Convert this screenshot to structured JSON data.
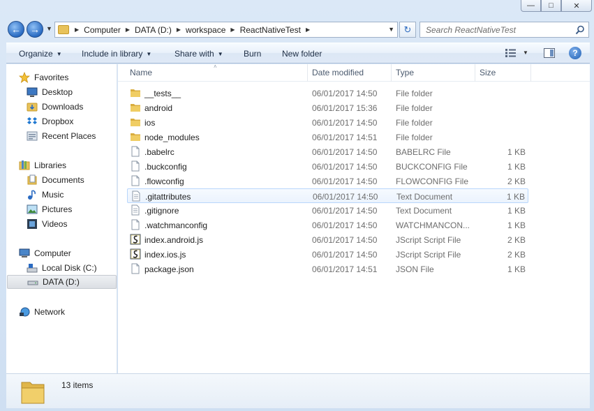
{
  "window": {
    "controls": {
      "minimize": "—",
      "maximize": "□",
      "close": "✕"
    }
  },
  "address": {
    "crumbs": [
      "Computer",
      "DATA (D:)",
      "workspace",
      "ReactNativeTest"
    ]
  },
  "search": {
    "placeholder": "Search ReactNativeTest"
  },
  "toolbar": {
    "organize": "Organize",
    "include_in_library": "Include in library",
    "share_with": "Share with",
    "burn": "Burn",
    "new_folder": "New folder"
  },
  "nav": {
    "favorites": "Favorites",
    "desktop": "Desktop",
    "downloads": "Downloads",
    "dropbox": "Dropbox",
    "recent_places": "Recent Places",
    "libraries": "Libraries",
    "documents": "Documents",
    "music": "Music",
    "pictures": "Pictures",
    "videos": "Videos",
    "computer": "Computer",
    "local_disk": "Local Disk (C:)",
    "data_drive": "DATA (D:)",
    "network": "Network"
  },
  "columns": {
    "name": "Name",
    "date": "Date modified",
    "type": "Type",
    "size": "Size"
  },
  "files": [
    {
      "name": "__tests__",
      "date": "06/01/2017 14:50",
      "type": "File folder",
      "size": "",
      "kind": "folder"
    },
    {
      "name": "android",
      "date": "06/01/2017 15:36",
      "type": "File folder",
      "size": "",
      "kind": "folder"
    },
    {
      "name": "ios",
      "date": "06/01/2017 14:50",
      "type": "File folder",
      "size": "",
      "kind": "folder"
    },
    {
      "name": "node_modules",
      "date": "06/01/2017 14:51",
      "type": "File folder",
      "size": "",
      "kind": "folder"
    },
    {
      "name": ".babelrc",
      "date": "06/01/2017 14:50",
      "type": "BABELRC File",
      "size": "1 KB",
      "kind": "file"
    },
    {
      "name": ".buckconfig",
      "date": "06/01/2017 14:50",
      "type": "BUCKCONFIG File",
      "size": "1 KB",
      "kind": "file"
    },
    {
      "name": ".flowconfig",
      "date": "06/01/2017 14:50",
      "type": "FLOWCONFIG File",
      "size": "2 KB",
      "kind": "file"
    },
    {
      "name": ".gitattributes",
      "date": "06/01/2017 14:50",
      "type": "Text Document",
      "size": "1 KB",
      "kind": "text"
    },
    {
      "name": ".gitignore",
      "date": "06/01/2017 14:50",
      "type": "Text Document",
      "size": "1 KB",
      "kind": "text"
    },
    {
      "name": ".watchmanconfig",
      "date": "06/01/2017 14:50",
      "type": "WATCHMANCON...",
      "size": "1 KB",
      "kind": "file"
    },
    {
      "name": "index.android.js",
      "date": "06/01/2017 14:50",
      "type": "JScript Script File",
      "size": "2 KB",
      "kind": "script"
    },
    {
      "name": "index.ios.js",
      "date": "06/01/2017 14:50",
      "type": "JScript Script File",
      "size": "2 KB",
      "kind": "script"
    },
    {
      "name": "package.json",
      "date": "06/01/2017 14:51",
      "type": "JSON File",
      "size": "1 KB",
      "kind": "file"
    }
  ],
  "details": {
    "item_count": "13 items"
  },
  "colors": {
    "folder": "#e8c25a",
    "selection_border": "#b8d6fb",
    "accent": "#2a6bc2"
  }
}
